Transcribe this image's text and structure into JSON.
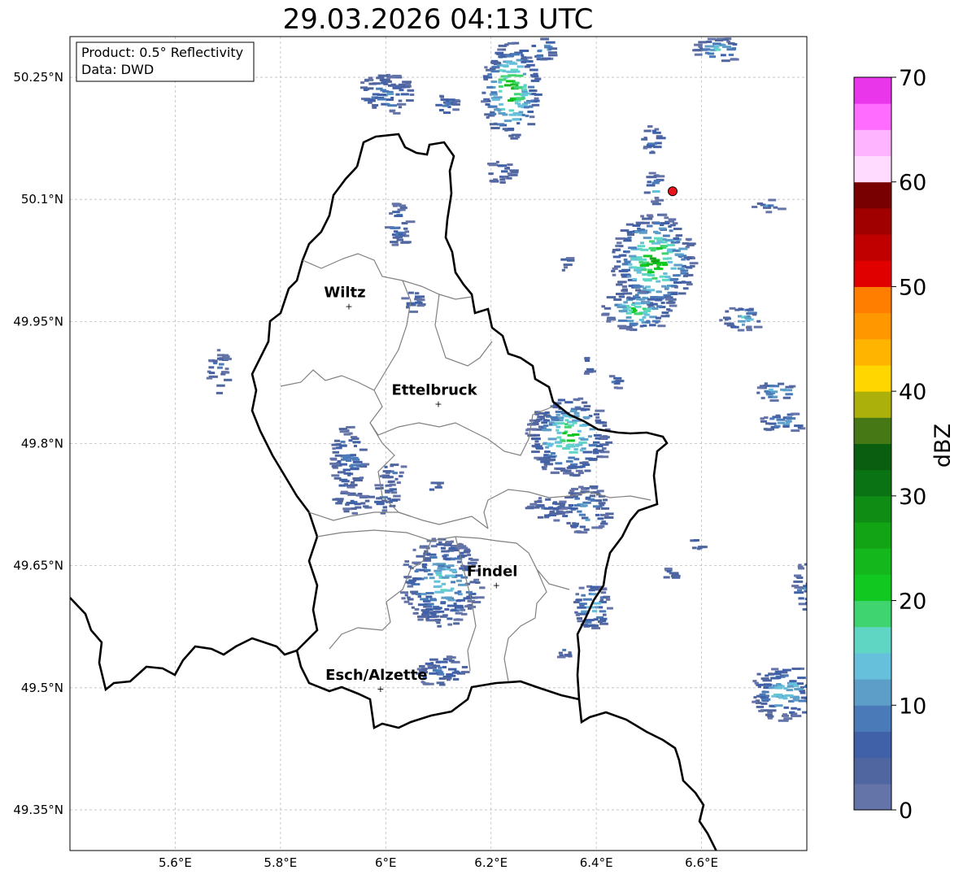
{
  "title": "29.03.2026 04:13 UTC",
  "info": {
    "product": "Product: 0.5° Reflectivity",
    "data": "Data: DWD"
  },
  "lat_ticks": [
    {
      "value": 50.25,
      "label": "50.25°N"
    },
    {
      "value": 50.1,
      "label": "50.1°N"
    },
    {
      "value": 49.95,
      "label": "49.95°N"
    },
    {
      "value": 49.8,
      "label": "49.8°N"
    },
    {
      "value": 49.65,
      "label": "49.65°N"
    },
    {
      "value": 49.5,
      "label": "49.5°N"
    },
    {
      "value": 49.35,
      "label": "49.35°N"
    }
  ],
  "lon_ticks": [
    {
      "value": 5.6,
      "label": "5.6°E"
    },
    {
      "value": 5.8,
      "label": "5.8°E"
    },
    {
      "value": 6.0,
      "label": "6°E"
    },
    {
      "value": 6.2,
      "label": "6.2°E"
    },
    {
      "value": 6.4,
      "label": "6.4°E"
    },
    {
      "value": 6.6,
      "label": "6.6°E"
    }
  ],
  "extent": {
    "lon_min": 5.4,
    "lon_max": 6.8,
    "lat_min": 49.3,
    "lat_max": 50.3
  },
  "cities": [
    {
      "name": "Wiltz",
      "lon": 5.93,
      "lat": 49.97
    },
    {
      "name": "Ettelbruck",
      "lon": 6.1,
      "lat": 49.85
    },
    {
      "name": "Findel",
      "lon": 6.21,
      "lat": 49.627
    },
    {
      "name": "Esch/Alzette",
      "lon": 5.99,
      "lat": 49.5
    }
  ],
  "marker": {
    "lon": 6.545,
    "lat": 50.11,
    "color": "#e8141c"
  },
  "colorbar": {
    "label": "dBZ",
    "ticks": [
      "0",
      "10",
      "20",
      "30",
      "40",
      "50",
      "60",
      "70"
    ],
    "vmin": 0,
    "vmax": 70,
    "colors": [
      "#6473a8",
      "#5066a0",
      "#4060a8",
      "#4a7ab8",
      "#5c9ec8",
      "#66c0dc",
      "#5fd6c4",
      "#40d470",
      "#10c820",
      "#14b81c",
      "#12a414",
      "#0e8c14",
      "#0a7414",
      "#0a5e10",
      "#467816",
      "#acb00a",
      "#ffd600",
      "#ffb400",
      "#ff9800",
      "#ff7e00",
      "#e00000",
      "#c00000",
      "#a00000",
      "#780000",
      "#ffdcff",
      "#ffb4ff",
      "#ff6cff",
      "#ea36ea"
    ]
  }
}
